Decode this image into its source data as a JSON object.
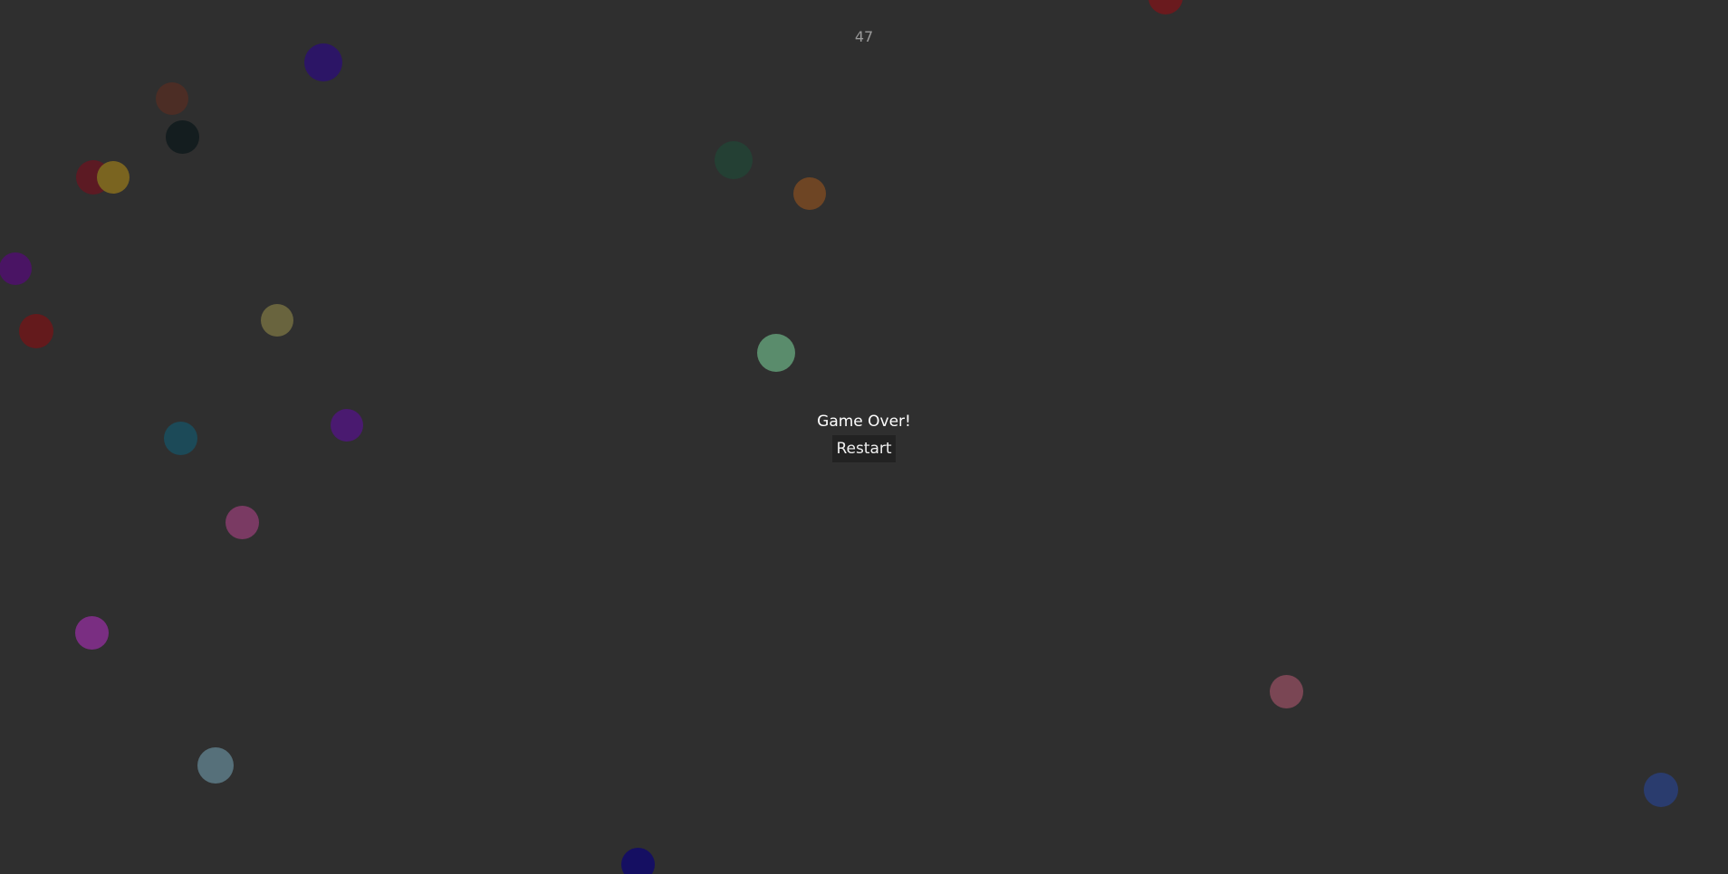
{
  "hud": {
    "score": "47"
  },
  "overlay": {
    "message": "Game Over!",
    "restart_label": "Restart"
  },
  "balls": [
    {
      "color": "#2c1566"
    },
    {
      "color": "#4c2d25"
    },
    {
      "color": "#141d1f"
    },
    {
      "color": "#5c1a23"
    },
    {
      "color": "#7a6420"
    },
    {
      "color": "#4a1464"
    },
    {
      "color": "#641a1c"
    },
    {
      "color": "#69643e"
    },
    {
      "color": "#244034"
    },
    {
      "color": "#6e4524"
    },
    {
      "color": "#5a8c6c"
    },
    {
      "color": "#4a1a70"
    },
    {
      "color": "#1c4a58"
    },
    {
      "color": "#7a3a63"
    },
    {
      "color": "#7a2e82"
    },
    {
      "color": "#56707a"
    },
    {
      "color": "#150f62"
    },
    {
      "color": "#7a4654"
    },
    {
      "color": "#2a3c6e"
    },
    {
      "color": "#6a1a1e"
    }
  ]
}
